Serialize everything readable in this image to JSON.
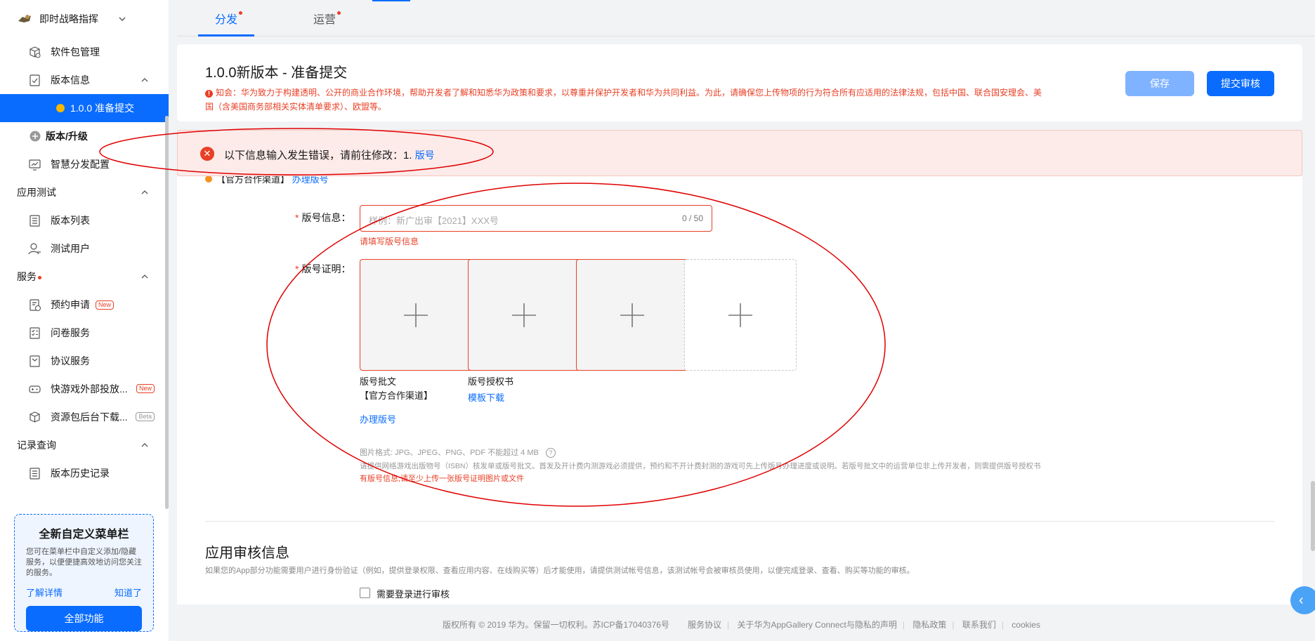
{
  "sidebar": {
    "app_name": "即时战略指挥",
    "items": {
      "package_mgmt": "软件包管理",
      "version_info": "版本信息",
      "version_active": "1.0.0 准备提交",
      "version_upgrade": "版本/升级",
      "smart_dist": "智慧分发配置"
    },
    "sections": {
      "app_test": "应用测试",
      "services": "服务",
      "records": "记录查询"
    },
    "test_items": [
      "版本列表",
      "测试用户"
    ],
    "service_items": {
      "reservation": "预约申请",
      "survey": "问卷服务",
      "agreement": "协议服务",
      "quickgame": "快游戏外部投放...",
      "resource": "资源包后台下载..."
    },
    "tags": {
      "new": "New",
      "beta": "Beta"
    },
    "record_items": [
      "版本历史记录"
    ],
    "promo": {
      "title": "全新自定义菜单栏",
      "text": "您可在菜单栏中自定义添加/隐藏服务，以便便捷高效地访问您关注的服务。",
      "link_more": "了解详情",
      "link_ok": "知道了",
      "button": "全部功能"
    }
  },
  "tabs": [
    "分发",
    "运营"
  ],
  "header": {
    "title": "1.0.0新版本 - 准备提交",
    "notice": "知会：华为致力于构建透明、公开的商业合作环境，帮助开发者了解和知悉华为政策和要求，以尊重并保护开发者和华为共同利益。为此，请确保您上传物项的行为符合所有应适用的法律法规，包括中国、联合国安理会、美国（含美国商务部相关实体清单要求）、欧盟等。",
    "save": "保存",
    "submit": "提交审核"
  },
  "error_banner": {
    "message": "以下信息输入发生错误，请前往修改：1.",
    "link": "版号"
  },
  "form": {
    "cut_text": "【官方合作渠道】",
    "cut_link": "办理版号",
    "license_info_label": "版号信息：",
    "license_placeholder": "样例：新广出审【2021】XXX号",
    "license_count": "0 / 50",
    "license_error": "请填写版号信息",
    "license_proof_label": "版号证明：",
    "upload_captions": {
      "approval": "版号批文",
      "approval_channel": "【官方合作渠道】",
      "approval_link": "办理版号",
      "authorization": "版号授权书",
      "template_link": "模板下载"
    },
    "hint_format": "图片格式: JPG、JPEG、PNG、PDF 不能超过 4 MB",
    "hint_detail": "请提供网络游戏出版物号（ISBN）核发单或版号批文。首发及开计费内测游戏必须提供，预约和不开计费封测的游戏可先上传版号办理进度或说明。若版号批文中的运营单位非上传开发者，则需提供版号授权书",
    "hint_error": "有版号信息,请至少上传一张版号证明图片或文件"
  },
  "review": {
    "title": "应用审核信息",
    "desc": "如果您的App部分功能需要用户进行身份验证（例如，提供登录权限、查看应用内容、在线购买等）后才能使用，请提供测试帐号信息，该测试帐号会被审核员使用，以便完成登录、查看、购买等功能的审核。",
    "checkbox_label": "需要登录进行审核"
  },
  "footer": {
    "copyright": "版权所有 © 2019 华为。保留一切权利。苏ICP备17040376号",
    "links": [
      "服务协议",
      "关于华为AppGallery Connect与隐私的声明",
      "隐私政策",
      "联系我们",
      "cookies"
    ]
  },
  "colors": {
    "primary": "#0a6cfe",
    "error": "#e84026",
    "annotation": "#e00000"
  }
}
